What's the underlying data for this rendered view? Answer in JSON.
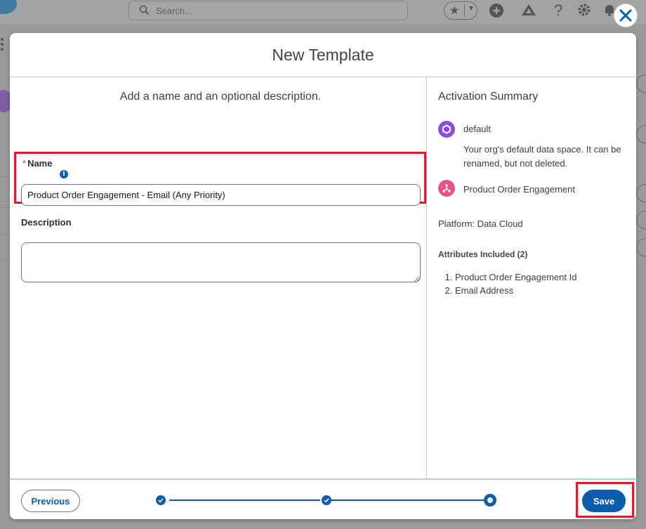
{
  "app": {
    "search_placeholder": "Search..."
  },
  "modal": {
    "title": "New Template",
    "instructions": "Add a name and an optional description.",
    "name_field": {
      "required_marker": "*",
      "label": "Name",
      "value": "Product Order Engagement - Email (Any Priority)"
    },
    "description_field": {
      "label": "Description",
      "value": ""
    }
  },
  "summary": {
    "title": "Activation Summary",
    "data_space": {
      "name": "default",
      "description": "Your org's default data space. It can be renamed, but not deleted."
    },
    "data_model": {
      "name": "Product Order Engagement"
    },
    "platform": "Platform: Data Cloud",
    "attributes_title": "Attributes Included (2)",
    "attributes": [
      "Product Order Engagement Id",
      "Email Address"
    ]
  },
  "footer": {
    "previous_label": "Previous",
    "save_label": "Save",
    "progress": {
      "total_steps": 3,
      "current_step": 3
    }
  },
  "colors": {
    "brand_blue": "#0b5cab",
    "highlight_red": "#d4202b",
    "data_space_purple": "#8a4fd6",
    "data_model_pink": "#e8538a"
  }
}
